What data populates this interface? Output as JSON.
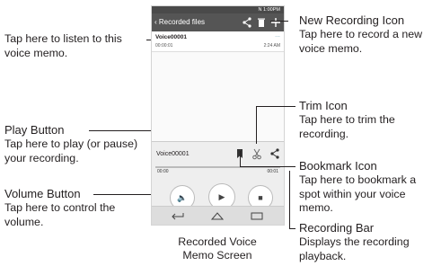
{
  "phone": {
    "status_text": "N 1:00PM",
    "app_title": "Recorded files",
    "recording": {
      "name": "Voice00001",
      "duration": "00:00:01",
      "time": "2:24 AM",
      "dots": "..."
    },
    "player": {
      "name": "Voice00001",
      "start": "00:00",
      "end": "00:01",
      "progress": 0.0
    }
  },
  "annotations": {
    "listen": {
      "text": "Tap here to listen to this voice memo."
    },
    "play": {
      "title": "Play Button",
      "text": "Tap here to play (or pause) your recording."
    },
    "volume": {
      "title": "Volume Button",
      "text": "Tap here to control the volume."
    },
    "new_recording": {
      "title": "New Recording Icon",
      "text": "Tap here to record a new voice memo."
    },
    "trim": {
      "title": "Trim Icon",
      "text": "Tap here to trim the recording."
    },
    "bookmark": {
      "title": "Bookmark Icon",
      "text": "Tap here to bookmark a spot within your voice memo."
    },
    "recording_bar": {
      "title": "Recording Bar",
      "text": "Displays the recording playback."
    }
  },
  "caption": "Recorded Voice Memo Screen"
}
